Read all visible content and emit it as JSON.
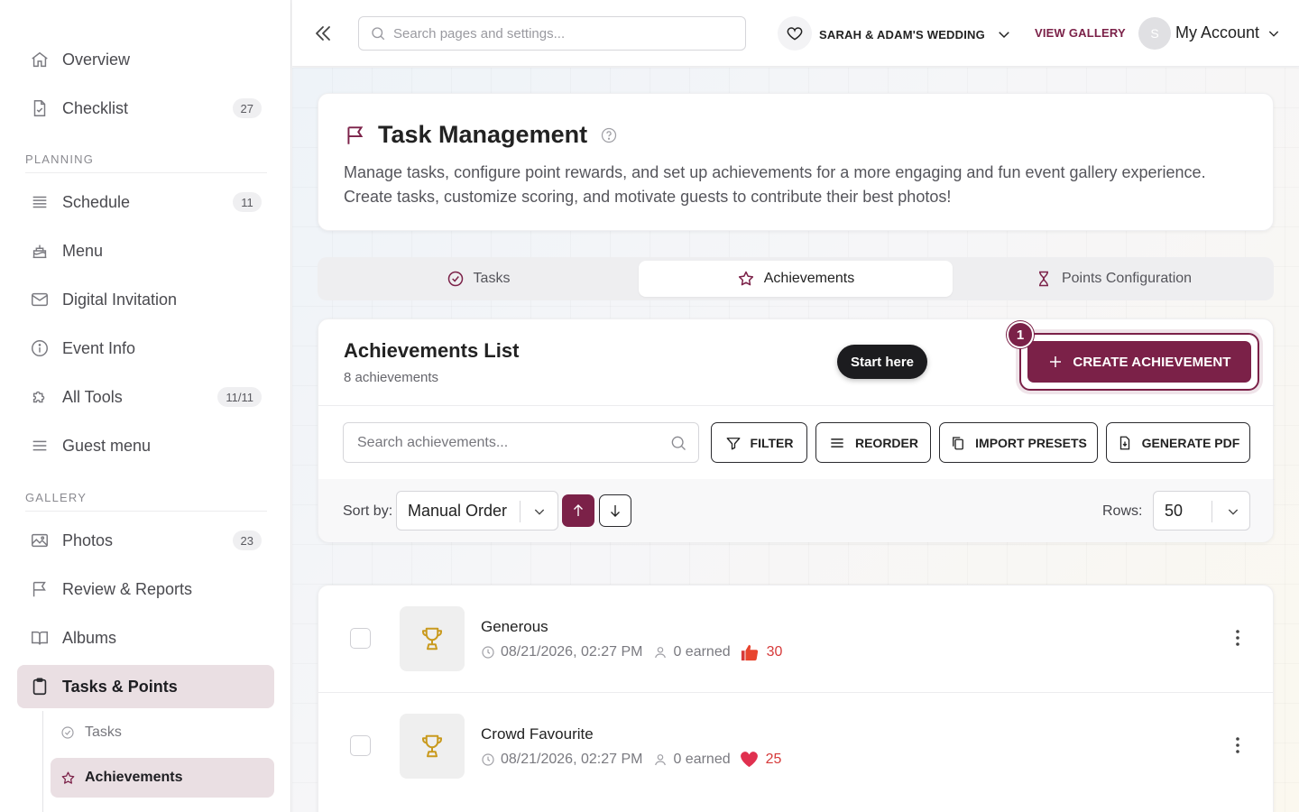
{
  "sidebar": {
    "items": [
      {
        "label": "Overview",
        "icon": "home-icon"
      },
      {
        "label": "Checklist",
        "icon": "document-check-icon",
        "badge": "27"
      }
    ],
    "planning_label": "PLANNING",
    "planning": [
      {
        "label": "Schedule",
        "icon": "list-icon",
        "badge": "11"
      },
      {
        "label": "Menu",
        "icon": "cake-icon"
      },
      {
        "label": "Digital Invitation",
        "icon": "envelope-icon"
      },
      {
        "label": "Event Info",
        "icon": "info-icon"
      },
      {
        "label": "All Tools",
        "icon": "puzzle-icon",
        "badge": "11/11"
      },
      {
        "label": "Guest menu",
        "icon": "menu-icon"
      }
    ],
    "gallery_label": "GALLERY",
    "gallery": [
      {
        "label": "Photos",
        "icon": "image-icon",
        "badge": "23"
      },
      {
        "label": "Review & Reports",
        "icon": "flag-icon"
      },
      {
        "label": "Albums",
        "icon": "book-icon"
      },
      {
        "label": "Tasks & Points",
        "icon": "clipboard-icon"
      }
    ],
    "sub": [
      {
        "label": "Tasks",
        "icon": "check-circle-icon"
      },
      {
        "label": "Achievements",
        "icon": "star-icon"
      }
    ]
  },
  "header": {
    "search_placeholder": "Search pages and settings...",
    "event_name": "SARAH & ADAM'S WEDDING",
    "view_gallery": "VIEW GALLERY",
    "avatar_initial": "S",
    "account": "My Account"
  },
  "page": {
    "title": "Task Management",
    "description": "Manage tasks, configure point rewards, and set up achievements for a more engaging and fun event gallery experience. Create tasks, customize scoring, and motivate guests to contribute their best photos!"
  },
  "tabs": [
    {
      "label": "Tasks",
      "icon": "check-circle-icon"
    },
    {
      "label": "Achievements",
      "icon": "star-icon",
      "active": true
    },
    {
      "label": "Points Configuration",
      "icon": "hourglass-trophy-icon"
    }
  ],
  "achievements": {
    "title": "Achievements List",
    "count": "8 achievements",
    "start_here": "Start here",
    "step": "1",
    "create_label": "CREATE ACHIEVEMENT",
    "search_placeholder": "Search achievements...",
    "filter": "FILTER",
    "reorder": "REORDER",
    "import_presets": "IMPORT PRESETS",
    "generate_pdf": "GENERATE PDF",
    "sort_by": "Sort by:",
    "sort_value": "Manual Order",
    "rows_label": "Rows:",
    "rows_value": "50",
    "items": [
      {
        "name": "Generous",
        "date": "08/21/2026, 02:27 PM",
        "earned": "0 earned",
        "points": "30",
        "points_icon": "thumbs-up-icon"
      },
      {
        "name": "Crowd Favourite",
        "date": "08/21/2026, 02:27 PM",
        "earned": "0 earned",
        "points": "25",
        "points_icon": "heart-icon"
      }
    ]
  },
  "colors": {
    "accent": "#7b2148",
    "active_bg": "#eadfe3",
    "trophy": "#c99a1e",
    "points": "#d63a3a"
  }
}
